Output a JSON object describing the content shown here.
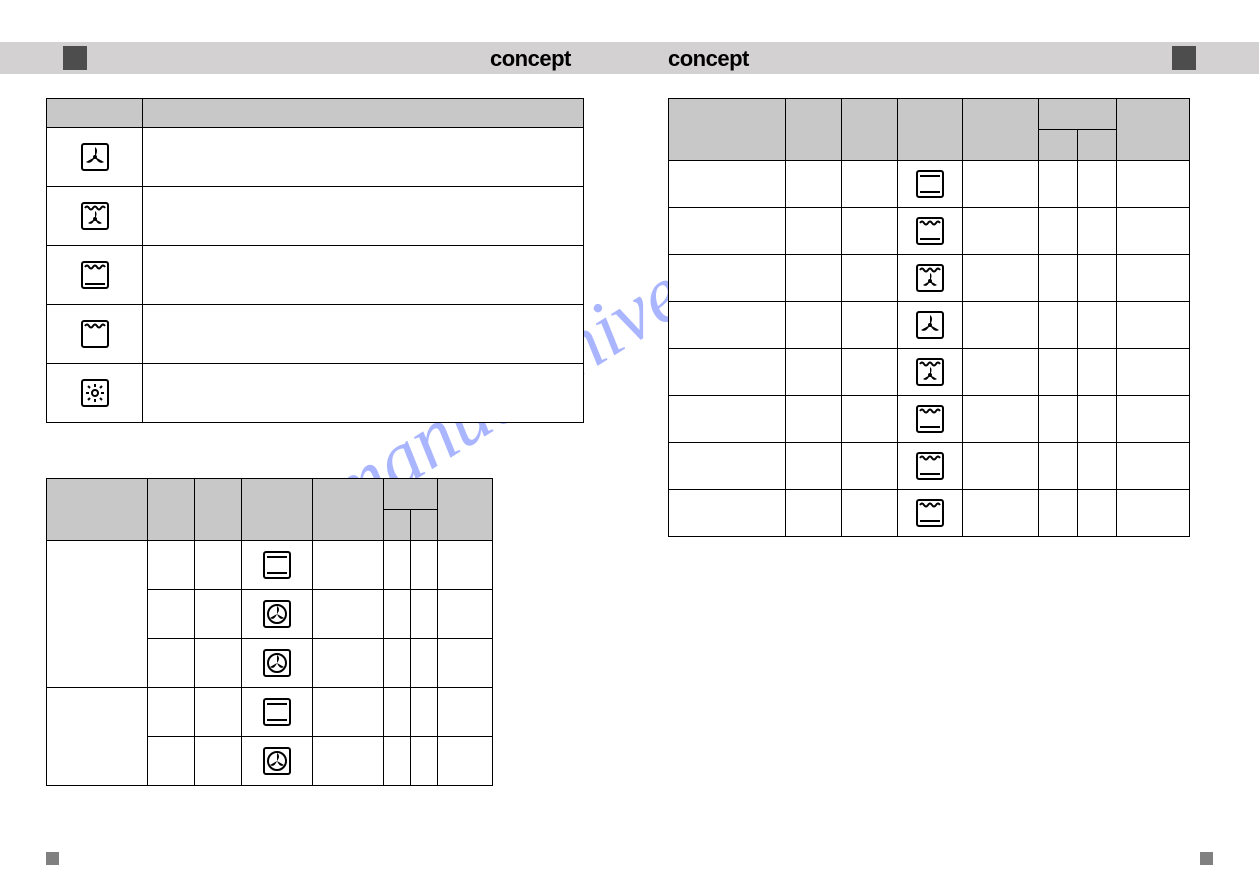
{
  "watermark": "manualshive.com",
  "brand_left": "concept",
  "brand_right": "concept",
  "table1": {
    "header": {
      "symbol": "",
      "description": ""
    },
    "rows": [
      {
        "icon": "fan"
      },
      {
        "icon": "grill-fan"
      },
      {
        "icon": "top-bottom"
      },
      {
        "icon": "top"
      },
      {
        "icon": "light"
      }
    ]
  },
  "table2": {
    "header": {
      "food": "",
      "weight": "",
      "water": "",
      "function": "",
      "temp": "",
      "level": "",
      "level_sub1": "",
      "level_sub2": "",
      "time": ""
    },
    "rows": [
      {
        "icon": "top-bottom-bar"
      },
      {
        "icon": "fan-filled"
      },
      {
        "icon": "fan-filled"
      },
      {
        "icon": "top-bottom-bar"
      },
      {
        "icon": "fan-filled"
      }
    ]
  },
  "table3": {
    "header": {
      "food": "",
      "weight": "",
      "water": "",
      "function": "",
      "temp": "",
      "level": "",
      "level_sub1": "",
      "level_sub2": "",
      "time": ""
    },
    "rows": [
      {
        "icon": "top-bottom-bar"
      },
      {
        "icon": "grill-top"
      },
      {
        "icon": "grill-fan"
      },
      {
        "icon": "fan"
      },
      {
        "icon": "grill-fan"
      },
      {
        "icon": "grill-top"
      },
      {
        "icon": "grill-top"
      },
      {
        "icon": "grill-top"
      }
    ]
  }
}
